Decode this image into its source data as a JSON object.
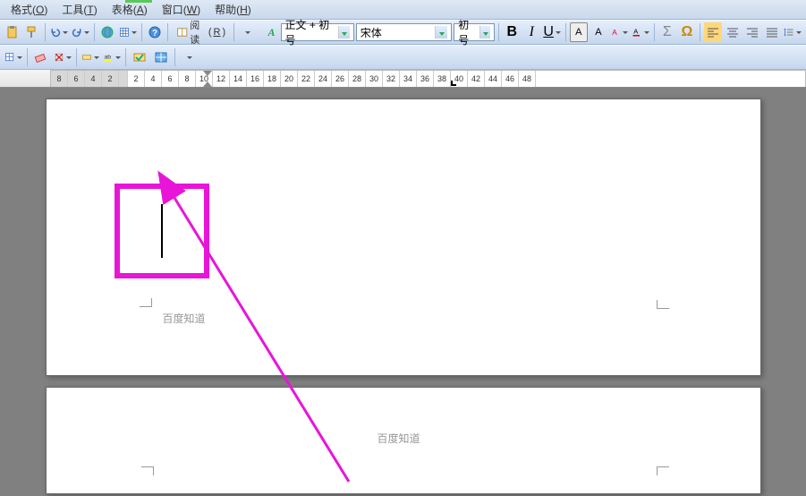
{
  "menubar": {
    "format": {
      "label": "格式",
      "key": "O"
    },
    "tools": {
      "label": "工具",
      "key": "T"
    },
    "table": {
      "label": "表格",
      "key": "A"
    },
    "window": {
      "label": "窗口",
      "key": "W"
    },
    "help": {
      "label": "帮助",
      "key": "H"
    }
  },
  "toolbar1": {
    "read_label": "阅读",
    "read_key": "R",
    "style_selector": "正文 + 初号",
    "font_selector": "宋体",
    "size_selector": "初号",
    "bold": "B",
    "italic": "I",
    "underline": "U",
    "format_A": "A",
    "format_A2": "A",
    "sigma": "Σ",
    "omega": "Ω"
  },
  "ruler": {
    "major_left": [
      "8",
      "6",
      "4",
      "2"
    ],
    "major_right": [
      "2",
      "4",
      "6",
      "8",
      "10",
      "12",
      "14",
      "16",
      "18",
      "20",
      "22",
      "24",
      "26",
      "28",
      "30",
      "32",
      "34",
      "36",
      "38",
      "40",
      "42",
      "44",
      "46",
      "48"
    ]
  },
  "page1": {
    "header_text": "百度知道"
  },
  "page2": {
    "footer_text": "百度知道"
  },
  "annotation": {
    "highlight_color": "#e815d8",
    "arrow_color": "#e815d8"
  }
}
